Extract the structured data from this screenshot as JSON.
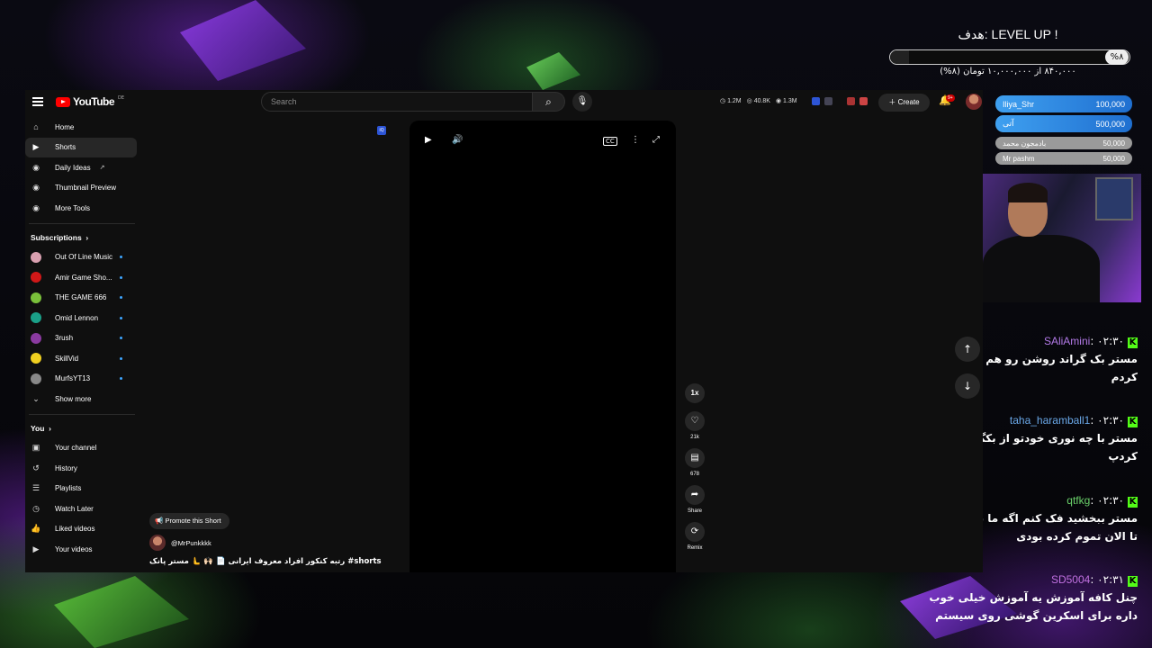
{
  "goal": {
    "title": "هدف: LEVEL UP !",
    "percent_label": "%۸",
    "progress": 0.08,
    "subtitle": "۸۴۰,۰۰۰ از ۱۰,۰۰۰,۰۰۰ تومان (۸%)"
  },
  "donors": [
    {
      "name": "Iliya_Shr",
      "amount": "100,000"
    },
    {
      "name": "آتی",
      "amount": "500,000"
    },
    {
      "name": "بادمجون محمد",
      "amount": "50,000"
    },
    {
      "name": "Mr pashm",
      "amount": "50,000"
    }
  ],
  "header": {
    "logo": "YouTube",
    "logo_region": "DE",
    "search_placeholder": "Search",
    "stats": [
      "1.2M",
      "40.8K",
      "1.3M"
    ],
    "create_label": "Create",
    "notif_count": "9+"
  },
  "sidebar": {
    "main": [
      {
        "label": "Home",
        "icon": "home-icon"
      },
      {
        "label": "Shorts",
        "icon": "shorts-icon"
      },
      {
        "label": "Daily Ideas",
        "icon": "extension-icon"
      },
      {
        "label": "Thumbnail Preview",
        "icon": "extension-icon"
      },
      {
        "label": "More Tools",
        "icon": "extension-icon"
      }
    ],
    "subscriptions_title": "Subscriptions",
    "subscriptions": [
      {
        "label": "Out Of Line Music",
        "color": "#d9a0b0"
      },
      {
        "label": "Amir Game Sho...",
        "color": "#d01818"
      },
      {
        "label": "THE GAME 666",
        "color": "#7ac03a"
      },
      {
        "label": "Omid Lennon",
        "color": "#1aa088"
      },
      {
        "label": "3rush",
        "color": "#8a3aa0"
      },
      {
        "label": "SkillVid",
        "color": "#f0d020"
      },
      {
        "label": "MurfsYT13",
        "color": "#888888"
      }
    ],
    "show_more": "Show more",
    "you_title": "You",
    "you": [
      {
        "label": "Your channel",
        "icon": "channel-icon"
      },
      {
        "label": "History",
        "icon": "history-icon"
      },
      {
        "label": "Playlists",
        "icon": "playlists-icon"
      },
      {
        "label": "Watch Later",
        "icon": "watch-later-icon"
      },
      {
        "label": "Liked videos",
        "icon": "like-icon"
      },
      {
        "label": "Your videos",
        "icon": "videos-icon"
      }
    ]
  },
  "short": {
    "promote": "Promote this Short",
    "channel": "@MrPunkkkk",
    "title": "رتبه کنکور افراد معروف ایرانی 📄 🙌🏻 🫷 مستر پانک #shorts",
    "speed": "1x",
    "likes": "21k",
    "comments": "678",
    "share": "Share",
    "remix": "Remix"
  },
  "chat": [
    {
      "user": "SAliAmini",
      "time": "۰۲:۳۰",
      "color": "#b37ae8",
      "text": [
        "مستر بک گراند روشن رو هم برا",
        "کردم"
      ]
    },
    {
      "user": "taha_haramball1",
      "time": "۰۲:۳۰",
      "color": "#6aa8e8",
      "text": [
        "مستر با چه نوری خودتو از بکگر",
        "کردپ"
      ]
    },
    {
      "user": "qtfkg",
      "time": "۰۲:۳۰",
      "color": "#6ad06a",
      "text": [
        "مستر ببخشید فک کنم اگه ما نب",
        "تا الان تموم کرده بودی"
      ]
    },
    {
      "user": "SD5004",
      "time": "۰۲:۳۱",
      "color": "#c070e0",
      "text": [
        "چنل کافه آموزش یه آموزش خیلی خوب",
        "داره برای اسکرین گوشی روی سیستم"
      ]
    }
  ]
}
